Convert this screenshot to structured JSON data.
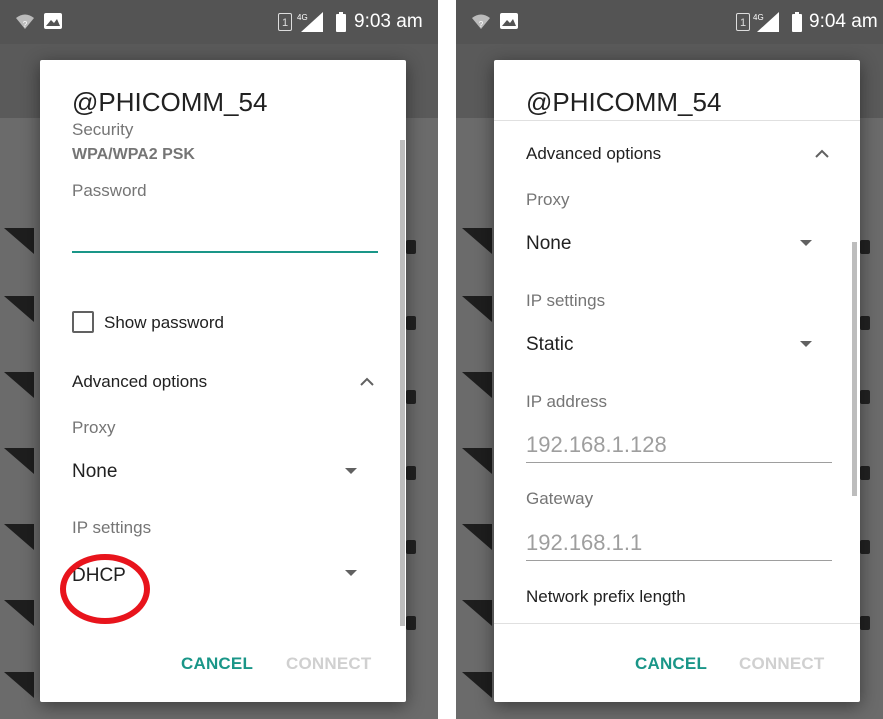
{
  "left": {
    "status_bar": {
      "sim_slot": "1",
      "network": "4G",
      "time": "9:03 am"
    },
    "dialog": {
      "title": "@PHICOMM_54",
      "security_label": "Security",
      "security_value": "WPA/WPA2 PSK",
      "password_label": "Password",
      "password_value": "",
      "show_password_label": "Show password",
      "advanced_options_label": "Advanced options",
      "proxy_label": "Proxy",
      "proxy_value": "None",
      "ip_settings_label": "IP settings",
      "ip_settings_value": "DHCP",
      "cancel_label": "CANCEL",
      "connect_label": "CONNECT"
    }
  },
  "right": {
    "status_bar": {
      "sim_slot": "1",
      "network": "4G",
      "time": "9:04 am"
    },
    "dialog": {
      "title": "@PHICOMM_54",
      "advanced_options_label": "Advanced options",
      "proxy_label": "Proxy",
      "proxy_value": "None",
      "ip_settings_label": "IP settings",
      "ip_settings_value": "Static",
      "ip_address_label": "IP address",
      "ip_address_placeholder": "192.168.1.128",
      "gateway_label": "Gateway",
      "gateway_placeholder": "192.168.1.1",
      "prefix_label": "Network prefix length",
      "cancel_label": "CANCEL",
      "connect_label": "CONNECT"
    }
  },
  "colors": {
    "accent": "#1a9688",
    "highlight_circle": "#e8141c"
  }
}
